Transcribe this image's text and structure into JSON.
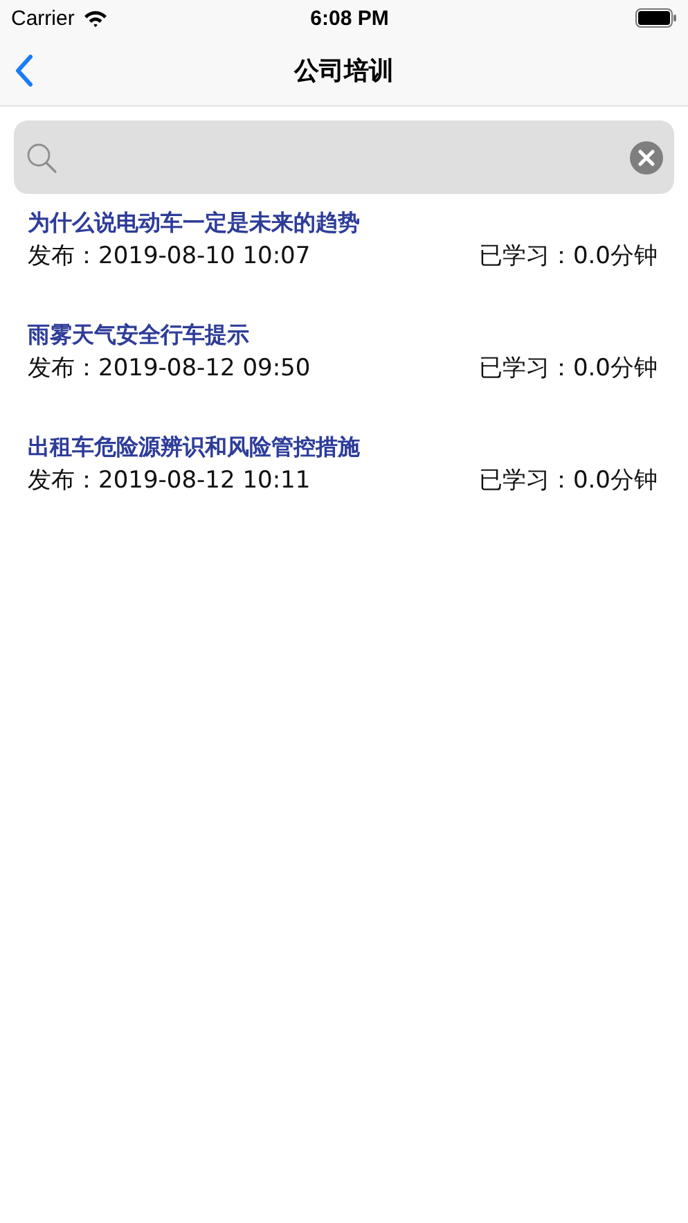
{
  "status_bar": {
    "carrier": "Carrier",
    "time": "6:08 PM"
  },
  "nav_bar": {
    "title": "公司培训"
  },
  "articles": [
    {
      "title": "为什么说电动车一定是未来的趋势",
      "published": "发布：2019-08-10 10:07",
      "studied": "已学习：0.0分钟"
    },
    {
      "title": "雨雾天气安全行车提示",
      "published": "发布：2019-08-12 09:50",
      "studied": "已学习：0.0分钟"
    },
    {
      "title": "出租车危险源辨识和风险管控措施",
      "published": "发布：2019-08-12 10:11",
      "studied": "已学习：0.0分钟"
    }
  ]
}
